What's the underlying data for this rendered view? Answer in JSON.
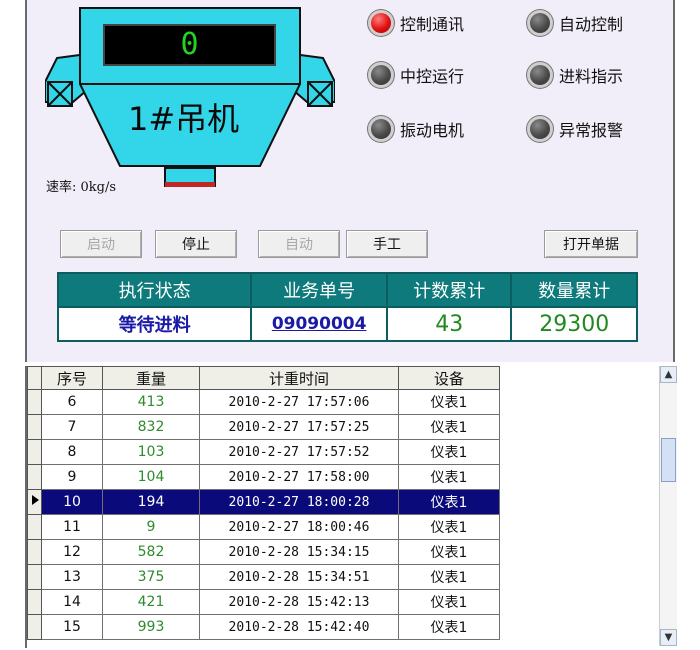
{
  "crane": {
    "display_value": "0",
    "name": "1#吊机",
    "speed_text": "速率: 0kg/s"
  },
  "indicators": [
    {
      "label": "控制通讯",
      "on": true
    },
    {
      "label": "自动控制",
      "on": false
    },
    {
      "label": "中控运行",
      "on": false
    },
    {
      "label": "进料指示",
      "on": false
    },
    {
      "label": "振动电机",
      "on": false
    },
    {
      "label": "异常报警",
      "on": false
    }
  ],
  "buttons": {
    "start": "启动",
    "stop": "停止",
    "auto": "自动",
    "manual": "手工",
    "open_order": "打开单据"
  },
  "status": {
    "headers": [
      "执行状态",
      "业务单号",
      "计数累计",
      "数量累计"
    ],
    "state": "等待进料",
    "order_no": "09090004",
    "count_total": "43",
    "quantity_total": "29300"
  },
  "grid": {
    "headers": [
      "序号",
      "重量",
      "计重时间",
      "设备"
    ],
    "selected_row": 4,
    "rows": [
      [
        "6",
        "413",
        "2010-2-27 17:57:06",
        "仪表1"
      ],
      [
        "7",
        "832",
        "2010-2-27 17:57:25",
        "仪表1"
      ],
      [
        "8",
        "103",
        "2010-2-27 17:57:52",
        "仪表1"
      ],
      [
        "9",
        "104",
        "2010-2-27 17:58:00",
        "仪表1"
      ],
      [
        "10",
        "194",
        "2010-2-27 18:00:28",
        "仪表1"
      ],
      [
        "11",
        "9",
        "2010-2-27 18:00:46",
        "仪表1"
      ],
      [
        "12",
        "582",
        "2010-2-28 15:34:15",
        "仪表1"
      ],
      [
        "13",
        "375",
        "2010-2-28 15:34:51",
        "仪表1"
      ],
      [
        "14",
        "421",
        "2010-2-28 15:42:13",
        "仪表1"
      ],
      [
        "15",
        "993",
        "2010-2-28 15:42:40",
        "仪表1"
      ]
    ]
  },
  "colors": {
    "panel_bg": "#f1eef9",
    "hopper": "#33d6e8",
    "header_teal": "#0e7a7c",
    "selected_row": "#0a0a7a",
    "weight_green": "#2e8b2e",
    "lamp_on": "#e01010"
  },
  "icons": {
    "row_pointer": "row-pointer-icon",
    "scroll_up": "scroll-up-icon",
    "scroll_down": "scroll-down-icon"
  }
}
